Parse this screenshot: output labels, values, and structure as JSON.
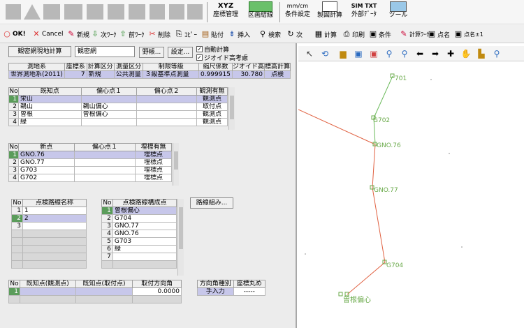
{
  "colors": {
    "accent_green": "#5a9c5a",
    "selection": "#c7c7ea",
    "route_green": "#6aba5a",
    "route_red": "#e06040",
    "point_label": "#6aaa4a"
  },
  "topbar": {
    "shape_icons": [
      "square-icon",
      "triangle-icon",
      "tripod-icon",
      "surface-icon",
      "box-icon",
      "box-icon",
      "box-icon",
      "map-icon",
      "book-icon"
    ],
    "buttons": [
      {
        "label": "座標管理",
        "sub": "XYZ"
      },
      {
        "label": "区画結線",
        "sub": ""
      },
      {
        "label": "条件設定",
        "sub": "mm/cm"
      },
      {
        "label": "製図計算",
        "sub": ""
      },
      {
        "label": "外部ﾃﾞｰﾀ",
        "sub": "SIM TXT"
      },
      {
        "label": "ツール",
        "sub": ""
      }
    ]
  },
  "toolbar2": {
    "items": [
      {
        "label": "OK!",
        "icon": "○"
      },
      {
        "label": "Cancel",
        "icon": "✕"
      },
      {
        "label": "新規",
        "icon": "✎"
      },
      {
        "label": "次ﾜｰｸ",
        "icon": "⇩"
      },
      {
        "label": "前ﾜｰｸ",
        "icon": "⇧"
      },
      {
        "label": "削除",
        "icon": "✂"
      },
      {
        "label": "ｺﾋﾟｰ",
        "icon": "⎘"
      },
      {
        "label": "貼付",
        "icon": "▤"
      },
      {
        "label": "挿入",
        "icon": "⇟"
      },
      {
        "label": "検索",
        "icon": "⚲"
      },
      {
        "label": "次",
        "icon": "↻"
      },
      {
        "label": "計算",
        "icon": "▦"
      },
      {
        "label": "印刷",
        "icon": "⎙"
      },
      {
        "label": "条件",
        "icon": "▣"
      },
      {
        "label": "計算ﾜｰｸ",
        "icon": "✎"
      },
      {
        "label": "点名",
        "icon": "▣"
      },
      {
        "label": "点名±1",
        "icon": "▣"
      }
    ]
  },
  "form": {
    "calc_button": "観密網現地計算",
    "network_name": "観密網",
    "browse_button": "野帳...",
    "settings_button": "設定...",
    "auto_calc": "自動計算",
    "geoid": "ジオイド高考慮"
  },
  "info_table": {
    "headers": [
      "測地系",
      "座標系",
      "計算区分",
      "測量区分",
      "制限等級",
      "縮尺係数",
      "ジオイド高",
      "標高計算"
    ],
    "row": [
      "世界測地系(2011)",
      "7",
      "新規",
      "公共測量",
      "３級基準点測量",
      "0.999915",
      "30.780",
      "点検"
    ]
  },
  "known_table": {
    "headers": [
      "No",
      "既知点",
      "偏心点１",
      "偏心点２",
      "観測有無"
    ],
    "rows": [
      [
        "1",
        "栄山",
        "",
        "",
        "観測点"
      ],
      [
        "2",
        "鵜山",
        "鵜山偏心",
        "",
        "取付点"
      ],
      [
        "3",
        "曽根",
        "曽根偏心",
        "",
        "観測点"
      ],
      [
        "4",
        "緑",
        "",
        "",
        "観測点"
      ]
    ]
  },
  "new_table": {
    "headers": [
      "No",
      "新点",
      "偏心点１",
      "埋標有無"
    ],
    "rows": [
      [
        "1",
        "GNO.76",
        "",
        "埋標点"
      ],
      [
        "2",
        "GNO.77",
        "",
        "埋標点"
      ],
      [
        "3",
        "G703",
        "",
        "埋標点"
      ],
      [
        "4",
        "G702",
        "",
        "埋標点"
      ]
    ]
  },
  "route_table": {
    "headers": [
      "No",
      "点検路線名称"
    ],
    "rows": [
      [
        "1",
        "1"
      ],
      [
        "2",
        "2"
      ],
      [
        "3",
        ""
      ]
    ]
  },
  "route_points_table": {
    "headers": [
      "No",
      "点検路線構成点"
    ],
    "rows": [
      [
        "1",
        "曽根偏心"
      ],
      [
        "2",
        "G704"
      ],
      [
        "3",
        "GNO.77"
      ],
      [
        "4",
        "GNO.76"
      ],
      [
        "5",
        "G703"
      ],
      [
        "6",
        "緑"
      ],
      [
        "7",
        ""
      ]
    ]
  },
  "route_build_button": "路線組み...",
  "angle_table": {
    "headers": [
      "No",
      "既知点(観測点)",
      "既知点(取付点)",
      "取付方向角"
    ],
    "rows": [
      [
        "1",
        "",
        "",
        "0.0000"
      ]
    ]
  },
  "direction_table": {
    "headers": [
      "方向角種別",
      "座標丸め"
    ],
    "row": [
      "手入力",
      "-----"
    ]
  },
  "map": {
    "points": [
      {
        "label": "701"
      },
      {
        "label": "G702"
      },
      {
        "label": "GNO.76"
      },
      {
        "label": "GNO.77"
      },
      {
        "label": "G704"
      },
      {
        "label": "曽根偏心"
      }
    ]
  }
}
